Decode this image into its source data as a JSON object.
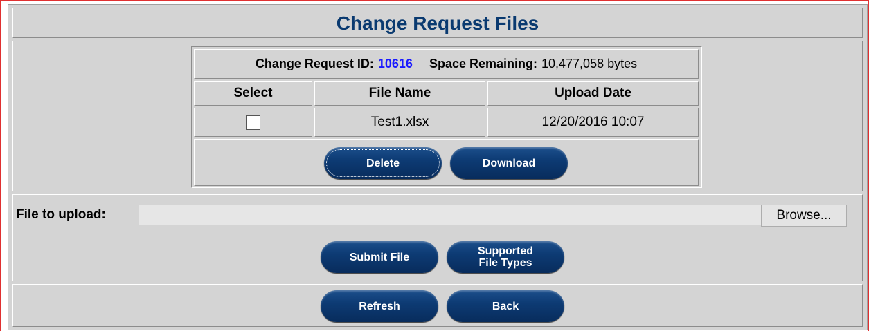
{
  "page": {
    "title": "Change Request Files"
  },
  "info": {
    "id_label": "Change Request ID:",
    "id_value": "10616",
    "space_label": "Space Remaining:",
    "space_value": "10,477,058 bytes"
  },
  "table": {
    "columns": [
      "Select",
      "File Name",
      "Upload Date"
    ],
    "rows": [
      {
        "selected": false,
        "file_name": "Test1.xlsx",
        "upload_date": "12/20/2016 10:07"
      }
    ]
  },
  "actions": {
    "delete": "Delete",
    "download": "Download"
  },
  "upload": {
    "label": "File to upload:",
    "value": "",
    "browse": "Browse...",
    "submit": "Submit File",
    "supported_line1": "Supported",
    "supported_line2": "File Types"
  },
  "footer": {
    "refresh": "Refresh",
    "back": "Back"
  }
}
